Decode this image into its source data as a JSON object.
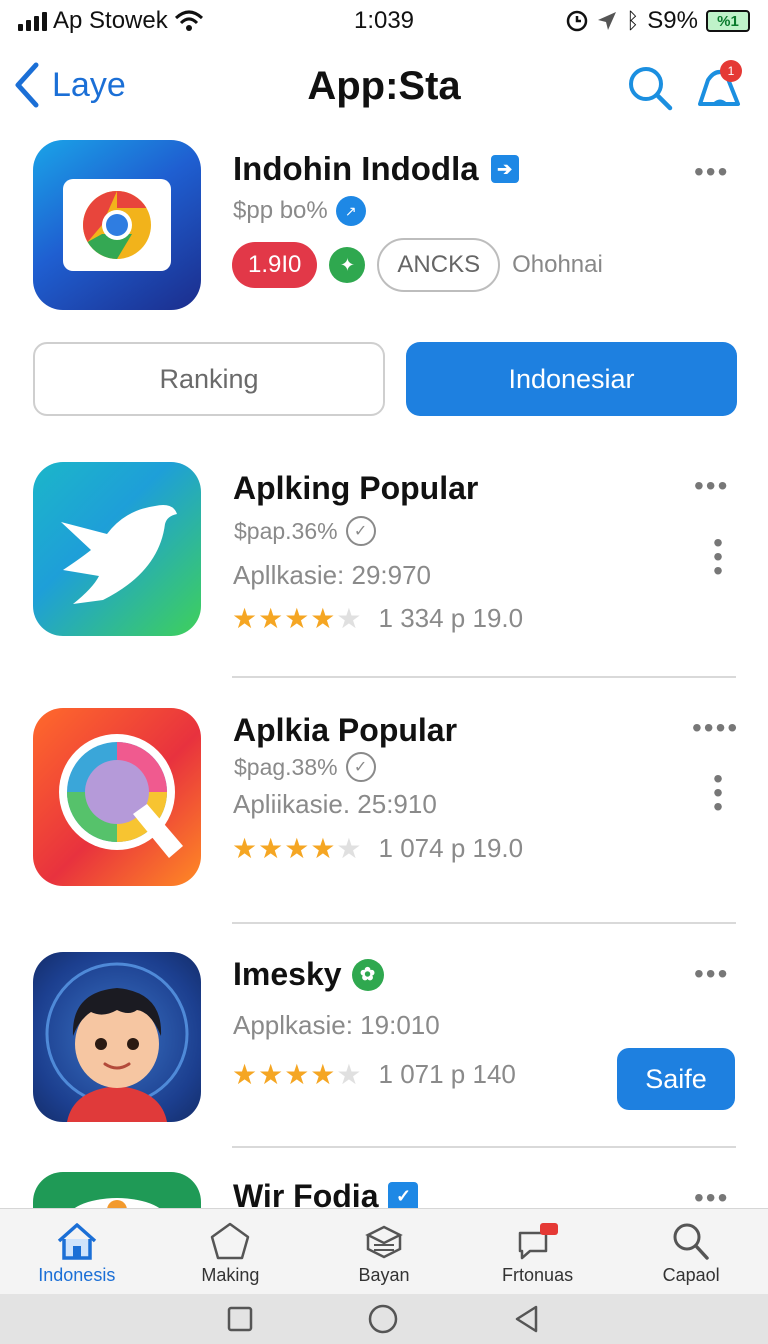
{
  "status_bar": {
    "carrier": "Ap Stowek",
    "time": "1:039",
    "battery_percent": "S9%",
    "battery_label": "%1"
  },
  "nav": {
    "back_label": "Laye",
    "title": "App:Sta",
    "badge": "1"
  },
  "header_app": {
    "name": "Indohin Indodla",
    "sub": "$pp bo%",
    "rank": "1.9I0",
    "tag": "ANCKS",
    "plain_tag": "Ohohnai"
  },
  "segments": {
    "left": "Ranking",
    "right": "Indonesiar"
  },
  "apps": [
    {
      "name": "Aplking Popular",
      "sub": "$pap.36%",
      "meta": "Apllkasie: 29:970",
      "rating": 4.5,
      "rating_text": "1 334 p 19.0"
    },
    {
      "name": "Aplkia Popular",
      "sub": "$pag.38%",
      "meta": "Apliikasie. 25:910",
      "rating": 4.5,
      "rating_text": "1 074 p 19.0"
    },
    {
      "name": "Imesky",
      "meta": "Applkasie: 19:010",
      "rating": 4.5,
      "rating_text": "1 071 p 140",
      "button": "Saife"
    },
    {
      "name": "Wir Fodia"
    }
  ],
  "tabs": [
    {
      "label": "Indonesis",
      "icon": "home-icon",
      "active": true
    },
    {
      "label": "Making",
      "icon": "pentagon-icon"
    },
    {
      "label": "Bayan",
      "icon": "stack-icon"
    },
    {
      "label": "Frtonuas",
      "icon": "chat-icon"
    },
    {
      "label": "Capaol",
      "icon": "search-icon"
    }
  ],
  "colors": {
    "accent": "#1e80e0",
    "rank_red": "#e23848",
    "green": "#2fa84f",
    "star": "#f5a623"
  }
}
